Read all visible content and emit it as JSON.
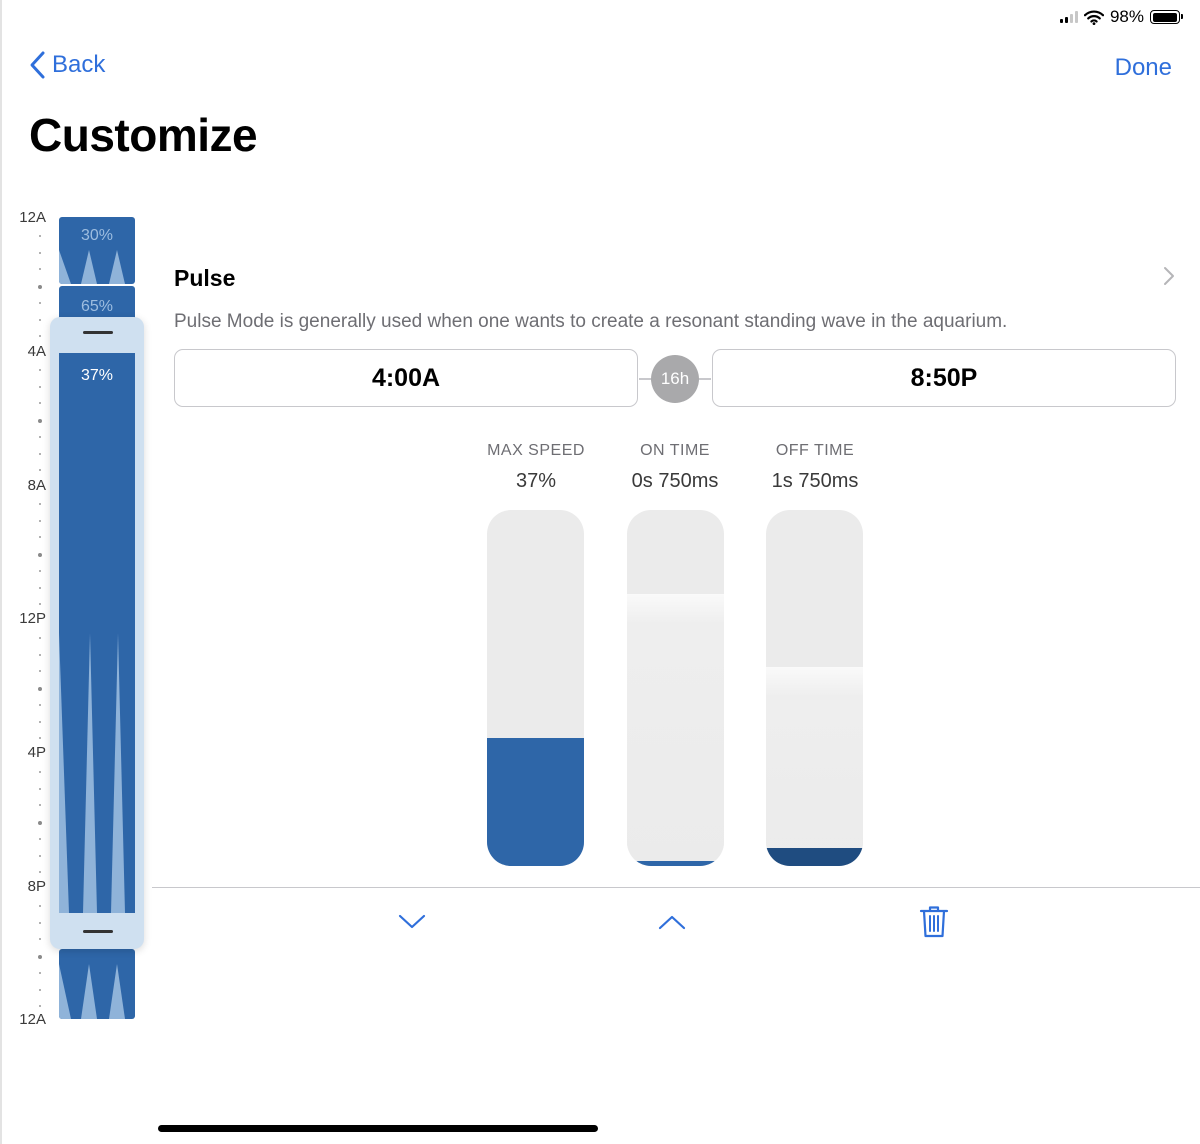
{
  "status": {
    "battery": "98%",
    "battery_level": 0.98,
    "signal_bars": 2
  },
  "nav": {
    "back_label": "Back",
    "done_label": "Done"
  },
  "page": {
    "title": "Customize"
  },
  "timeline": {
    "labels": [
      "12A",
      "4A",
      "8A",
      "12P",
      "4P",
      "8P",
      "12A"
    ],
    "segments": [
      {
        "label": "30%"
      },
      {
        "label": "65%"
      },
      {
        "label": "37%",
        "selected": true
      }
    ],
    "accent": "#2e66a8",
    "wave_color": "#8fb3d9"
  },
  "mode": {
    "name": "Pulse",
    "description": "Pulse Mode is generally used when one wants to create a resonant standing wave in the aquarium.",
    "start_time": "4:00A",
    "end_time": "8:50P",
    "duration": "16h"
  },
  "controls": [
    {
      "header": "MAX SPEED",
      "value": "37%",
      "level": 0.36,
      "lit": 0,
      "color": "#2e66a8"
    },
    {
      "header": "ON TIME",
      "value": "0s 750ms",
      "level": 0.015,
      "lit": 0.765,
      "color": "#2e66a8"
    },
    {
      "header": "OFF TIME",
      "value": "1s 750ms",
      "level": 0.05,
      "lit": 0.56,
      "color": "#1f4c80"
    }
  ],
  "toolbar": {
    "icons": [
      "chevron-down-icon",
      "chevron-up-icon",
      "trash-icon"
    ],
    "color": "#2f6fdb"
  }
}
